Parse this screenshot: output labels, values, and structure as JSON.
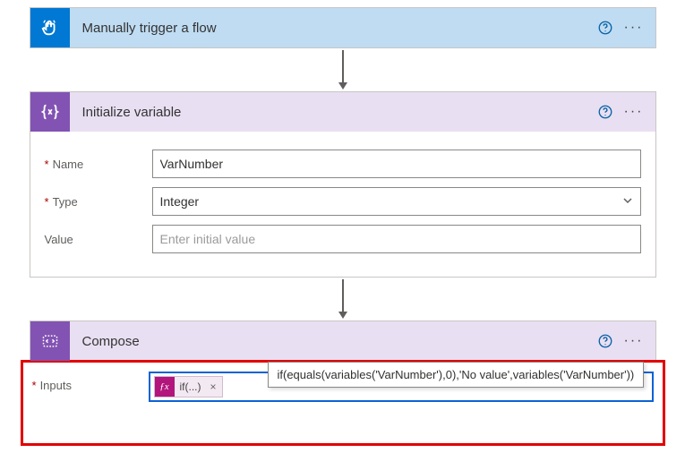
{
  "trigger": {
    "title": "Manually trigger a flow",
    "icon": "touch-icon"
  },
  "variable": {
    "title": "Initialize variable",
    "icon": "braces-icon",
    "fields": {
      "name_label": "Name",
      "name_value": "VarNumber",
      "type_label": "Type",
      "type_value": "Integer",
      "value_label": "Value",
      "value_placeholder": "Enter initial value"
    }
  },
  "compose": {
    "title": "Compose",
    "icon": "code-icon",
    "inputs_label": "Inputs",
    "token_label": "if(...)",
    "expression_full": "if(equals(variables('VarNumber'),0),'No value',variables('VarNumber'))"
  }
}
